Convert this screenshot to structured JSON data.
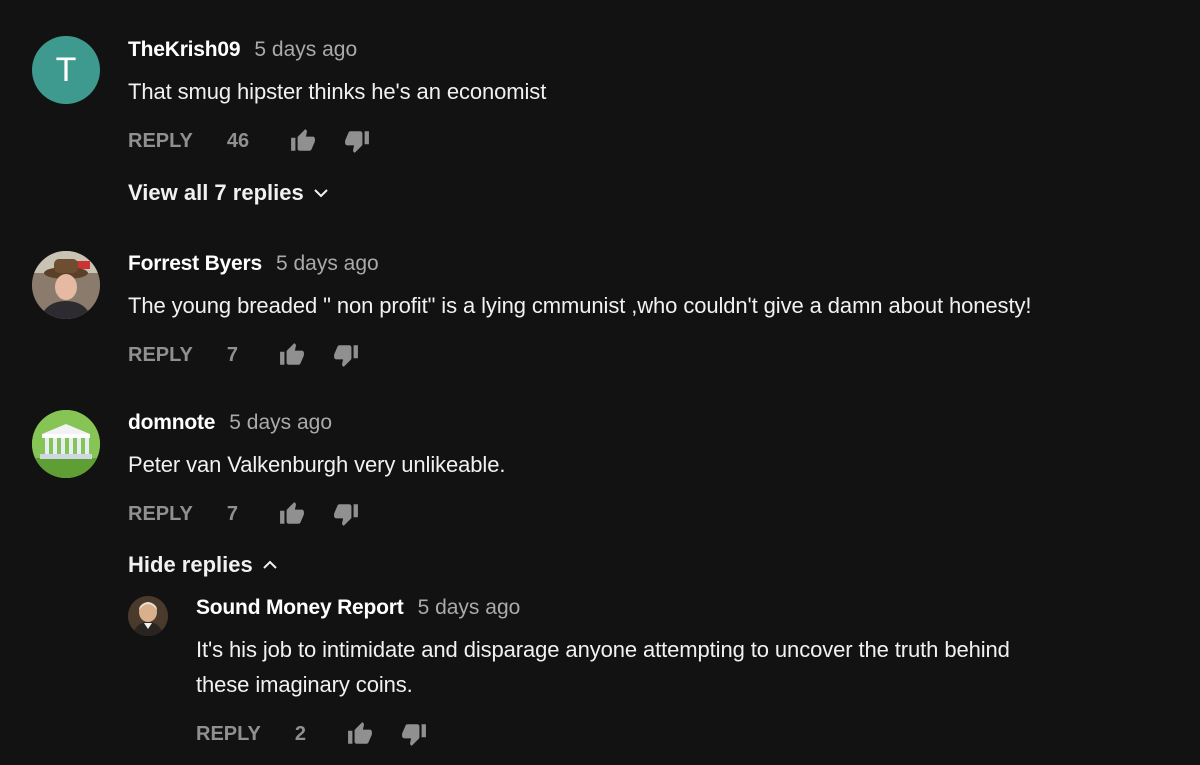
{
  "colors": {
    "background": "#121212",
    "meta_text": "#aaaaaa",
    "action_text": "#909090",
    "avatar_teal": "#3e9a8e",
    "avatar_green": "#8bc34a"
  },
  "comments": [
    {
      "avatar": {
        "type": "letter",
        "letter": "T"
      },
      "author": "TheKrish09",
      "time": "5 days ago",
      "text": "That smug hipster thinks he's an economist",
      "reply_label": "REPLY",
      "likes": "46",
      "replies_toggle": "View all 7 replies",
      "toggle_icon": "chevron-down-icon"
    },
    {
      "avatar": {
        "type": "photo",
        "icon": "person-with-hat"
      },
      "author": "Forrest Byers",
      "time": "5 days ago",
      "text": "The young breaded \" non profit\" is a lying cmmunist ,who couldn't give a damn about honesty!",
      "reply_label": "REPLY",
      "likes": "7"
    },
    {
      "avatar": {
        "type": "photo",
        "icon": "building-columns"
      },
      "author": "domnote",
      "time": "5 days ago",
      "text": "Peter van Valkenburgh very unlikeable.",
      "reply_label": "REPLY",
      "likes": "7",
      "replies_toggle": "Hide replies",
      "toggle_icon": "chevron-up-icon",
      "replies": [
        {
          "avatar": {
            "type": "photo",
            "icon": "portrait-colonial"
          },
          "author": "Sound Money Report",
          "time": "5 days ago",
          "text_line1": "It's his job to intimidate and disparage anyone attempting to uncover the truth behind",
          "text_line2": "these imaginary coins.",
          "reply_label": "REPLY",
          "likes": "2"
        }
      ]
    }
  ]
}
